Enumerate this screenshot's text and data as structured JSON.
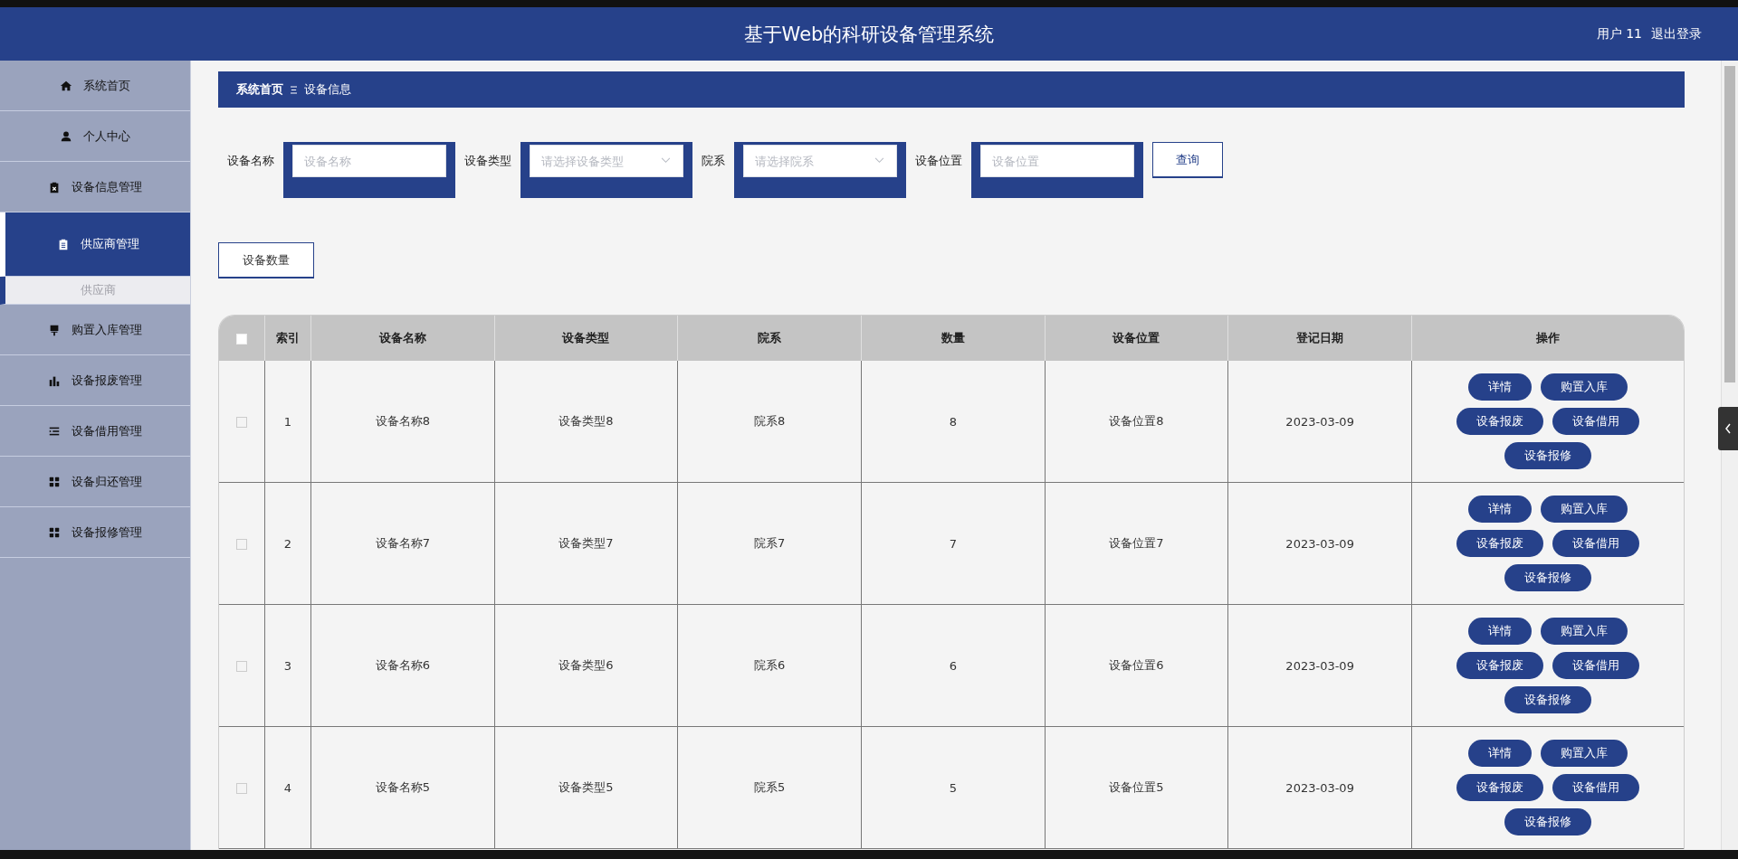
{
  "header": {
    "title": "基于Web的科研设备管理系统",
    "user": "用户 11",
    "logout": "退出登录"
  },
  "sidebar": {
    "items": [
      {
        "label": "系统首页",
        "kind": "home",
        "selected": false
      },
      {
        "label": "个人中心",
        "kind": "person",
        "selected": false
      },
      {
        "label": "设备信息管理",
        "kind": "clipboard-x",
        "selected": false
      },
      {
        "label": "供应商管理",
        "kind": "clipboard",
        "selected": true,
        "children": [
          {
            "label": "供应商",
            "selected": false
          }
        ]
      },
      {
        "label": "购置入库管理",
        "kind": "brush",
        "selected": false
      },
      {
        "label": "设备报废管理",
        "kind": "chart",
        "selected": false
      },
      {
        "label": "设备借用管理",
        "kind": "list",
        "selected": false
      },
      {
        "label": "设备归还管理",
        "kind": "grid",
        "selected": false
      },
      {
        "label": "设备报修管理",
        "kind": "grid",
        "selected": false
      }
    ]
  },
  "breadcrumb": [
    "系统首页",
    "设备信息"
  ],
  "search": {
    "fields": [
      {
        "label": "设备名称",
        "placeholder": "设备名称",
        "kind": "text"
      },
      {
        "label": "设备类型",
        "placeholder": "请选择设备类型",
        "kind": "select"
      },
      {
        "label": "院系",
        "placeholder": "请选择院系",
        "kind": "select"
      },
      {
        "label": "设备位置",
        "placeholder": "设备位置",
        "kind": "text"
      }
    ],
    "button": "查询"
  },
  "count_button": "设备数量",
  "table": {
    "select_all_checked": false,
    "columns": [
      "索引",
      "设备名称",
      "设备类型",
      "院系",
      "数量",
      "设备位置",
      "登记日期",
      "操作"
    ],
    "rows": [
      {
        "checked": false,
        "cells": [
          "1",
          "设备名称8",
          "设备类型8",
          "院系8",
          "8",
          "设备位置8",
          "2023-03-09"
        ],
        "actions": [
          "详情",
          "购置入库",
          "设备报废",
          "设备借用",
          "设备报修"
        ]
      },
      {
        "checked": false,
        "cells": [
          "2",
          "设备名称7",
          "设备类型7",
          "院系7",
          "7",
          "设备位置7",
          "2023-03-09"
        ],
        "actions": [
          "详情",
          "购置入库",
          "设备报废",
          "设备借用",
          "设备报修"
        ]
      },
      {
        "checked": false,
        "cells": [
          "3",
          "设备名称6",
          "设备类型6",
          "院系6",
          "6",
          "设备位置6",
          "2023-03-09"
        ],
        "actions": [
          "详情",
          "购置入库",
          "设备报废",
          "设备借用",
          "设备报修"
        ]
      },
      {
        "checked": false,
        "cells": [
          "4",
          "设备名称5",
          "设备类型5",
          "院系5",
          "5",
          "设备位置5",
          "2023-03-09"
        ],
        "actions": [
          "详情",
          "购置入库",
          "设备报废",
          "设备借用",
          "设备报修"
        ]
      }
    ]
  }
}
